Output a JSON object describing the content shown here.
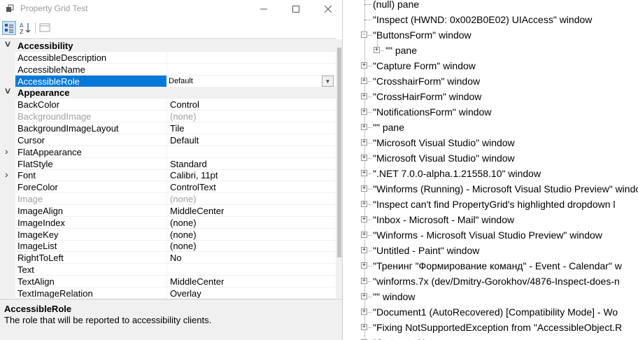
{
  "window": {
    "title": "Property Grid Test"
  },
  "toolbar": {
    "categorized_tip": "",
    "alphabetical_tip": ""
  },
  "grid": {
    "rows": [
      {
        "kind": "category",
        "name": "Accessibility",
        "value": ""
      },
      {
        "kind": "prop",
        "name": "AccessibleDescription",
        "value": ""
      },
      {
        "kind": "prop",
        "name": "AccessibleName",
        "value": ""
      },
      {
        "kind": "selected",
        "name": "AccessibleRole",
        "value": "Default"
      },
      {
        "kind": "category",
        "name": "Appearance",
        "value": ""
      },
      {
        "kind": "prop",
        "name": "BackColor",
        "value": "Control"
      },
      {
        "kind": "gray",
        "name": "BackgroundImage",
        "value": "(none)"
      },
      {
        "kind": "prop",
        "name": "BackgroundImageLayout",
        "value": "Tile"
      },
      {
        "kind": "prop",
        "name": "Cursor",
        "value": "Default"
      },
      {
        "kind": "expandable",
        "name": "FlatAppearance",
        "value": ""
      },
      {
        "kind": "prop",
        "name": "FlatStyle",
        "value": "Standard"
      },
      {
        "kind": "expandable",
        "name": "Font",
        "value": "Calibri, 11pt"
      },
      {
        "kind": "prop",
        "name": "ForeColor",
        "value": "ControlText"
      },
      {
        "kind": "gray",
        "name": "Image",
        "value": "(none)"
      },
      {
        "kind": "prop",
        "name": "ImageAlign",
        "value": "MiddleCenter"
      },
      {
        "kind": "prop",
        "name": "ImageIndex",
        "value": "(none)"
      },
      {
        "kind": "prop",
        "name": "ImageKey",
        "value": "(none)"
      },
      {
        "kind": "prop",
        "name": "ImageList",
        "value": "(none)"
      },
      {
        "kind": "prop",
        "name": "RightToLeft",
        "value": "No"
      },
      {
        "kind": "prop",
        "name": "Text",
        "value": ""
      },
      {
        "kind": "prop",
        "name": "TextAlign",
        "value": "MiddleCenter"
      },
      {
        "kind": "prop",
        "name": "TextImageRelation",
        "value": "Overlay"
      }
    ]
  },
  "help": {
    "title": "AccessibleRole",
    "description": "The role that will be reported to accessibility clients."
  },
  "tree": {
    "items": [
      {
        "level": 1,
        "box": "",
        "label": "(null) pane"
      },
      {
        "level": 1,
        "box": "",
        "label": "\"Inspect  (HWND: 0x002B0E02) UIAccess\" window"
      },
      {
        "level": 1,
        "box": "-",
        "label": "\"ButtonsForm\" window"
      },
      {
        "level": 2,
        "box": "+",
        "label": "\"\" pane"
      },
      {
        "level": 1,
        "box": "+",
        "label": "\"Capture Form\" window"
      },
      {
        "level": 1,
        "box": "+",
        "label": "\"CrosshairForm\" window"
      },
      {
        "level": 1,
        "box": "+",
        "label": "\"CrossHairForm\" window"
      },
      {
        "level": 1,
        "box": "+",
        "label": "\"NotificationsForm\" window"
      },
      {
        "level": 1,
        "box": "+",
        "label": "\"\" pane"
      },
      {
        "level": 1,
        "box": "+",
        "label": "\"Microsoft Visual Studio\" window"
      },
      {
        "level": 1,
        "box": "+",
        "label": "\"Microsoft Visual Studio\" window"
      },
      {
        "level": 1,
        "box": "+",
        "label": "\".NET 7.0.0-alpha.1.21558.10\" window"
      },
      {
        "level": 1,
        "box": "+",
        "label": "\"Winforms (Running) - Microsoft Visual Studio Preview\" window"
      },
      {
        "level": 1,
        "box": "+",
        "label": "\"Inspect can't find PropertyGrid's highlighted dropdown l"
      },
      {
        "level": 1,
        "box": "+",
        "label": "\"Inbox - Microsoft - Mail\" window"
      },
      {
        "level": 1,
        "box": "+",
        "label": "\"Winforms - Microsoft Visual Studio Preview\" window"
      },
      {
        "level": 1,
        "box": "+",
        "label": "\"Untitled - Paint\" window"
      },
      {
        "level": 1,
        "box": "+",
        "label": "\"Тренинг \"Формирование команд\" - Event - Calendar\" w"
      },
      {
        "level": 1,
        "box": "+",
        "label": "\"winforms.7x (dev/Dmitry-Gorokhov/4876-Inspect-does-n"
      },
      {
        "level": 1,
        "box": "+",
        "label": "\"\" window"
      },
      {
        "level": 1,
        "box": "+",
        "label": "\"Document1 (AutoRecovered) [Compatibility Mode] - Wo"
      },
      {
        "level": 1,
        "box": "+",
        "label": "\"Fixing NotSupportedException from \"AccessibleObject.R"
      },
      {
        "level": 1,
        "box": "+",
        "label": "\"Status to Not..."
      }
    ]
  },
  "colors": {
    "selection": "#0078d7",
    "category_bg": "#f0f0f0",
    "help_bg": "#f0f0f0"
  }
}
